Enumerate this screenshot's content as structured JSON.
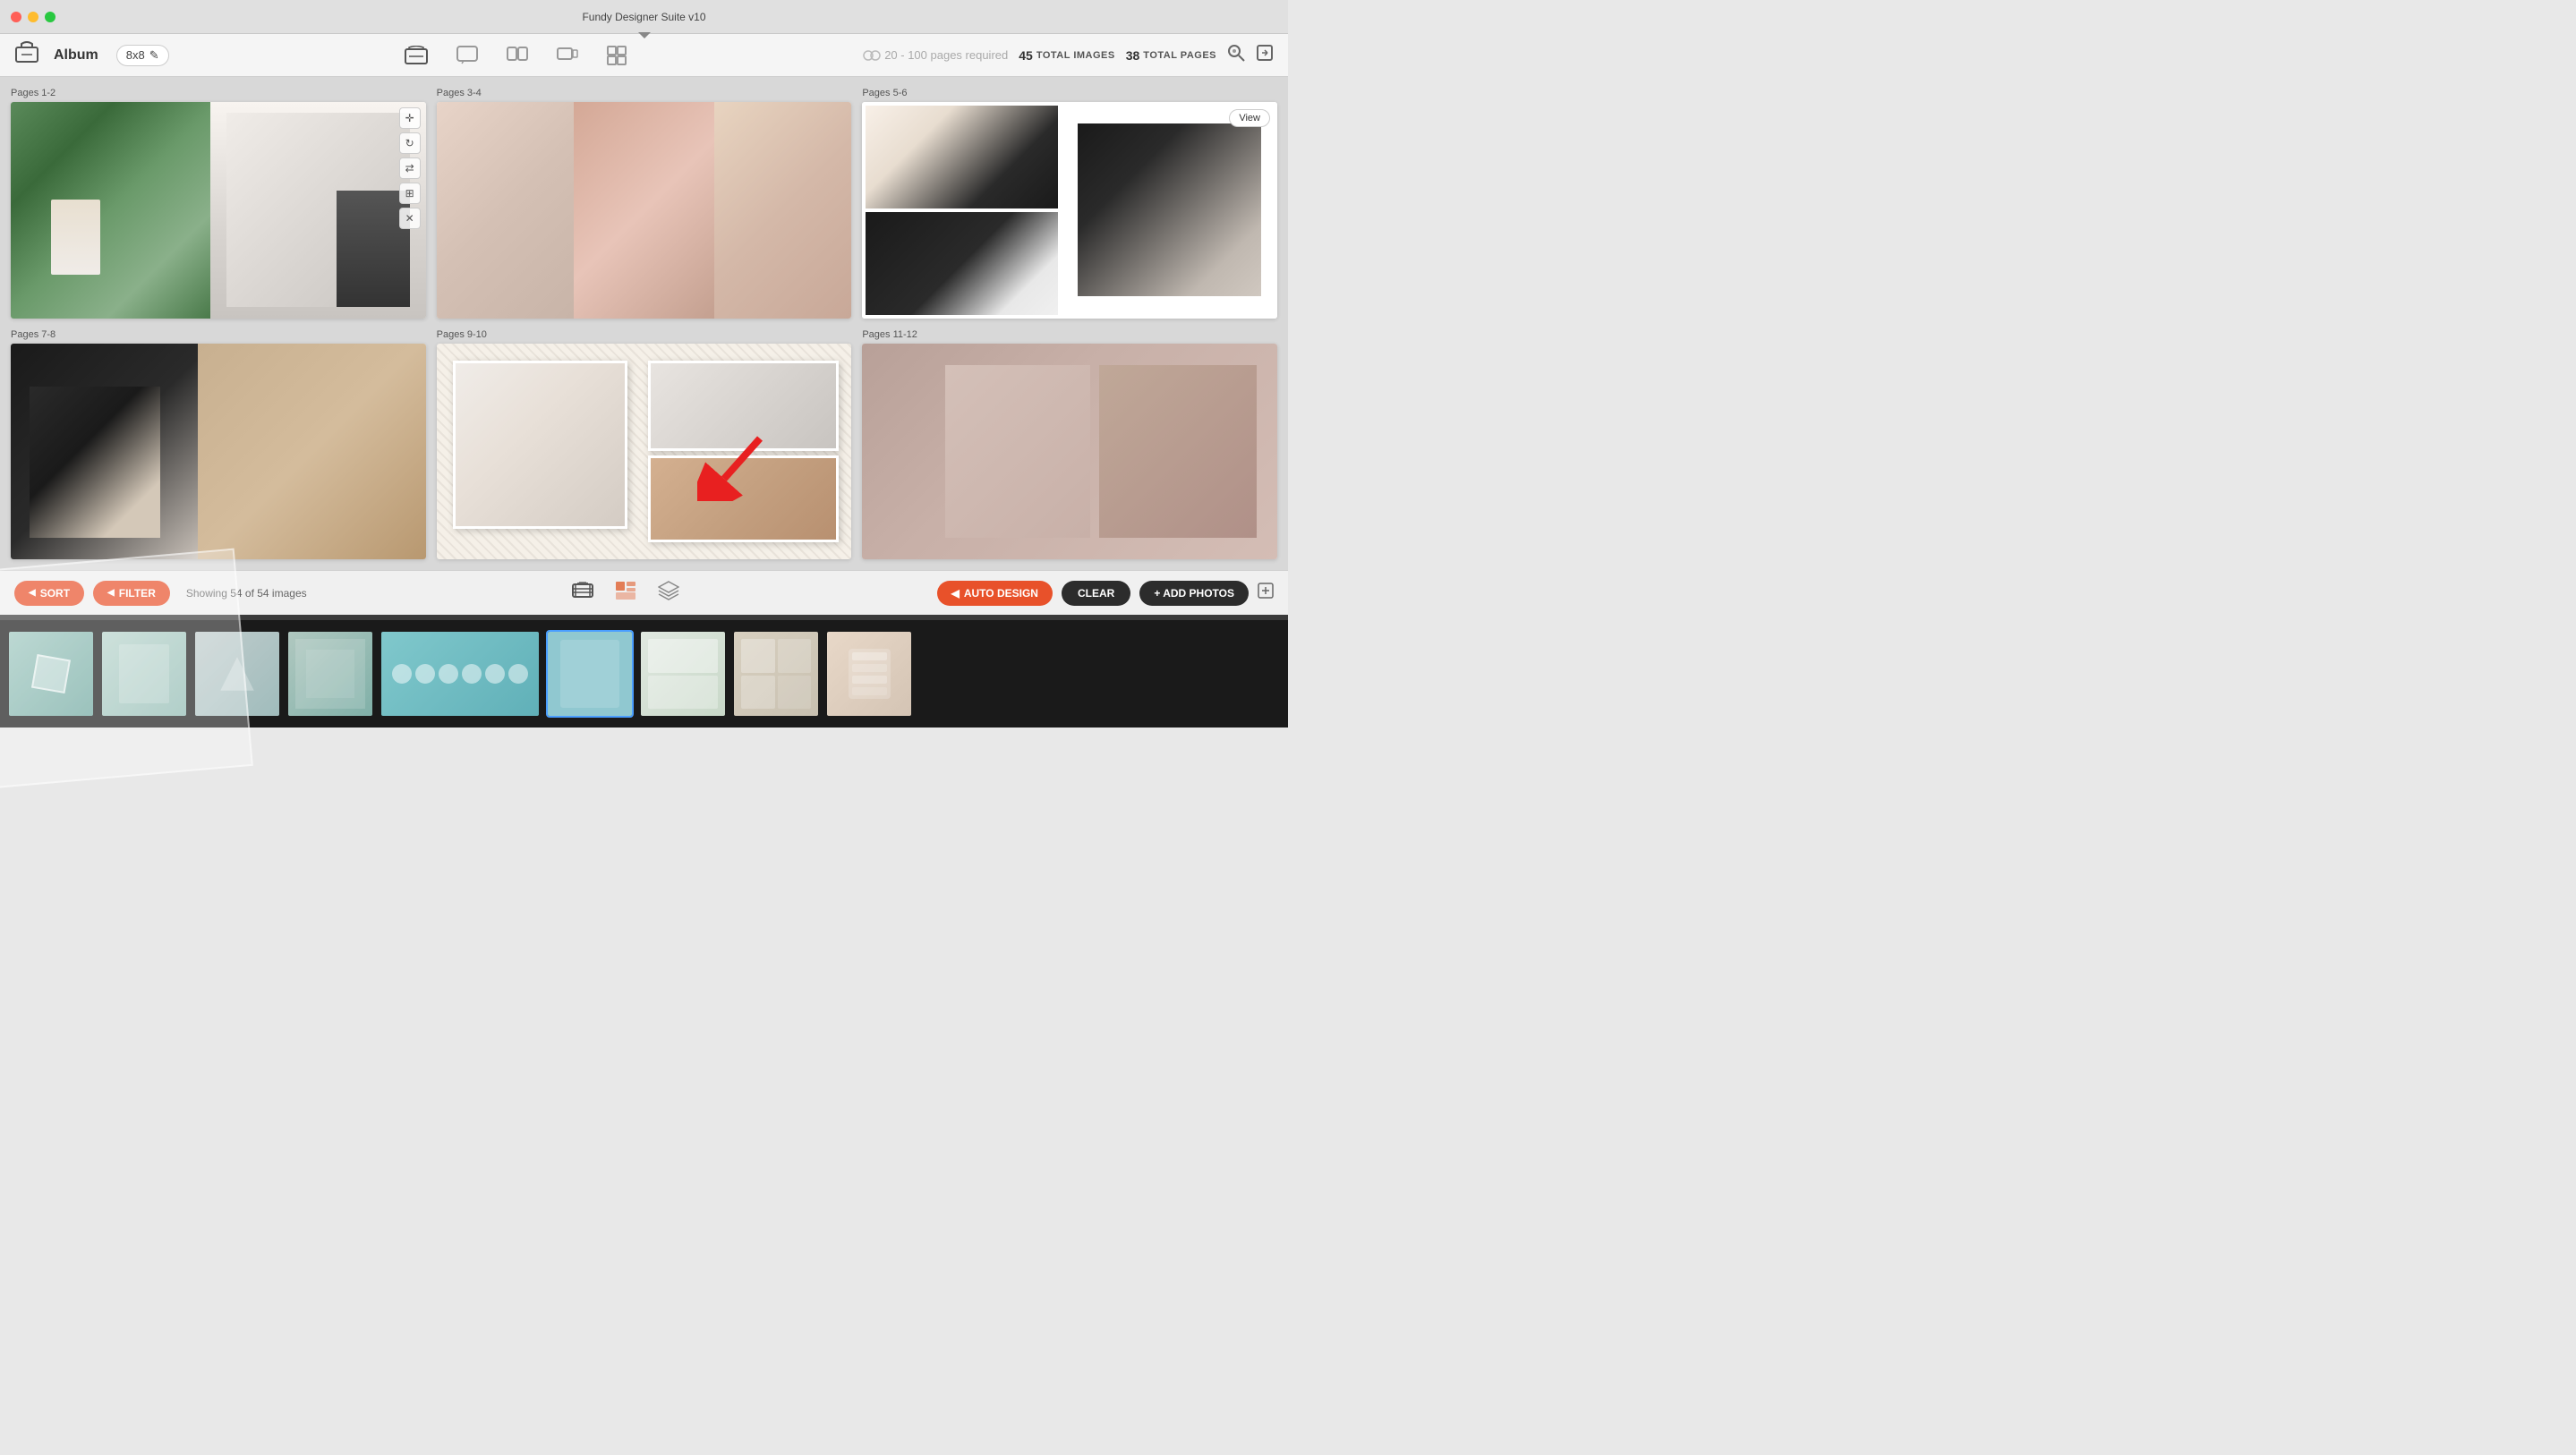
{
  "window": {
    "title": "Fundy Designer Suite v10"
  },
  "toolbar": {
    "album_label": "Album",
    "size_badge": "8x8",
    "edit_icon": "✎",
    "required_text": "20 - 100 pages required",
    "total_images_num": "45",
    "total_images_label": "TOTAL IMAGES",
    "total_pages_num": "38",
    "total_pages_label": "TOTAL PAGES"
  },
  "pages": [
    {
      "label": "Pages 1-2",
      "id": "page-1-2"
    },
    {
      "label": "Pages 3-4",
      "id": "page-3-4"
    },
    {
      "label": "Pages 5-6",
      "id": "page-5-6"
    },
    {
      "label": "Pages 7-8",
      "id": "page-7-8"
    },
    {
      "label": "Pages 9-10",
      "id": "page-9-10"
    },
    {
      "label": "Pages 11-12",
      "id": "page-11-12"
    }
  ],
  "view_button": "View",
  "bottom_toolbar": {
    "sort_label": "SORT",
    "filter_label": "FILTER",
    "showing_text": "Showing 54 of 54 images",
    "auto_design_label": "AUTO DESIGN",
    "clear_label": "CLEAR",
    "add_photos_label": "+ ADD PHOTOS"
  }
}
